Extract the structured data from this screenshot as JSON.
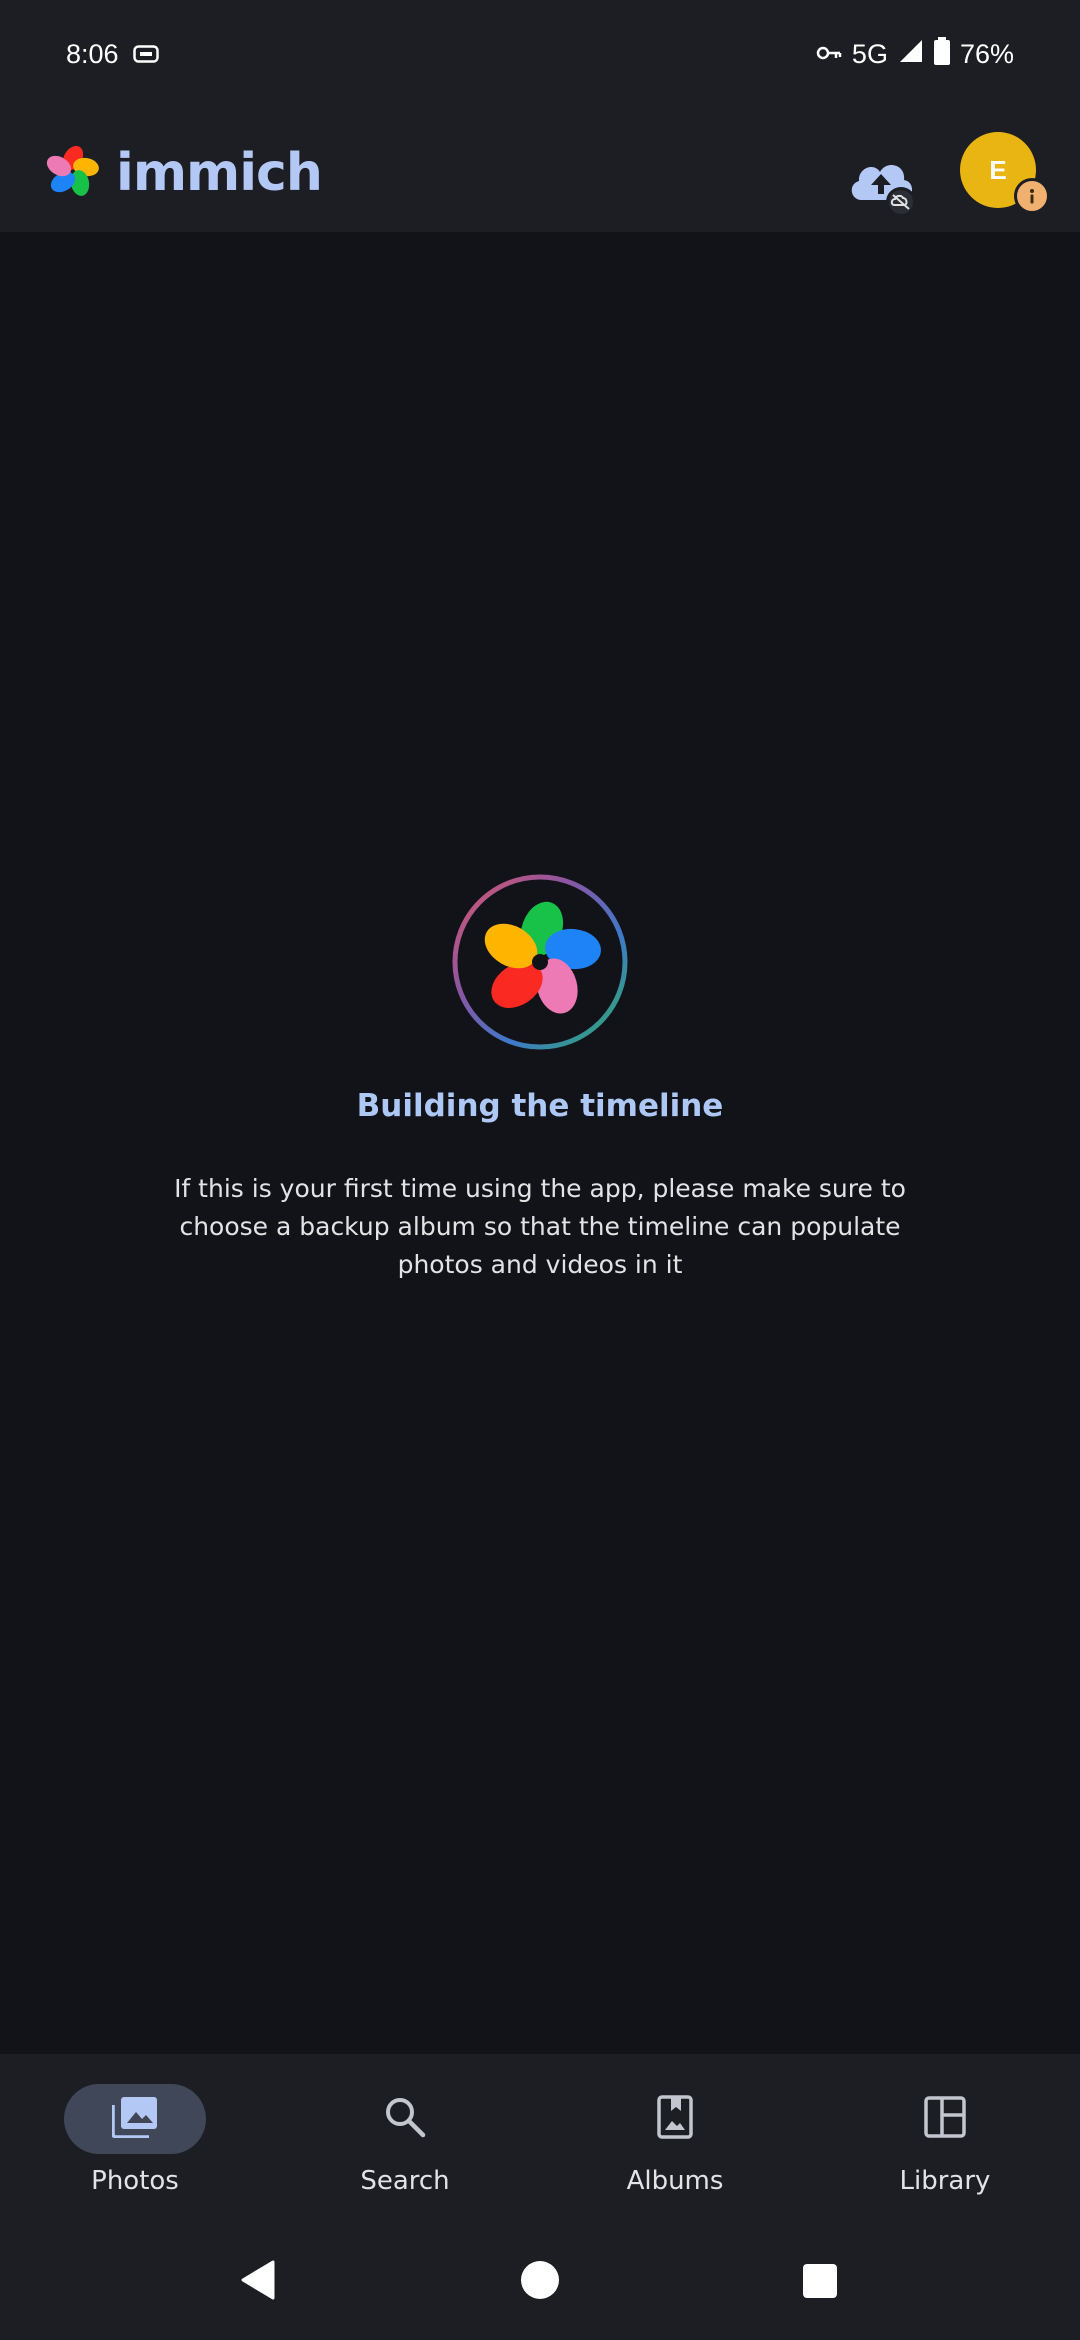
{
  "status_bar": {
    "time": "8:06",
    "network": "5G",
    "battery": "76%",
    "icons": [
      "screen-record-icon",
      "vpn-key-icon",
      "signal-icon",
      "battery-icon"
    ]
  },
  "app_bar": {
    "app_name": "immich",
    "avatar_initial": "E",
    "icons": [
      "cloud-upload-icon",
      "info-badge-icon"
    ]
  },
  "main": {
    "title": "Building the timeline",
    "description": "If this is your first time using the app, please make sure to choose a backup album so that the timeline can populate photos and videos in it"
  },
  "bottom_nav": {
    "items": [
      {
        "label": "Photos",
        "icon": "photos-icon",
        "active": true
      },
      {
        "label": "Search",
        "icon": "search-icon",
        "active": false
      },
      {
        "label": "Albums",
        "icon": "albums-icon",
        "active": false
      },
      {
        "label": "Library",
        "icon": "library-icon",
        "active": false
      }
    ]
  },
  "colors": {
    "background": "#121318",
    "surface": "#1c1e23",
    "accent": "#aec8f5",
    "avatar": "#e8b512",
    "active_pill": "#3f4758"
  }
}
